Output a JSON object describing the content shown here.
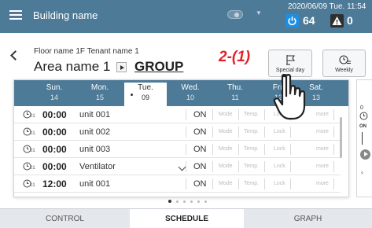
{
  "topbar": {
    "building_name": "Building name",
    "datetime": "2020/06/09 Tue. 11:54",
    "power_count": "64",
    "alert_count": "0",
    "dropdown_caret": "▼"
  },
  "header": {
    "floor_name": "Floor name 1F Tenant name 1",
    "area_name": "Area name 1",
    "group_label": "GROUP",
    "step_label": "2-(1)",
    "special_day_label": "Special day",
    "weekly_label": "Weekly"
  },
  "days": [
    {
      "name": "Sun.",
      "num": "14"
    },
    {
      "name": "Mon.",
      "num": "15"
    },
    {
      "name": "Tue.",
      "num": "09",
      "selected": true
    },
    {
      "name": "Wed.",
      "num": "10"
    },
    {
      "name": "Thu.",
      "num": "11"
    },
    {
      "name": "Fri.",
      "num": "12"
    },
    {
      "name": "Sat.",
      "num": "13"
    }
  ],
  "schedule_rows": [
    {
      "sub": "01",
      "time": "00:00",
      "name": "unit 001",
      "onoff": "ON",
      "mode": "Mode",
      "temp": "Temp.",
      "lock": "Lock",
      "more": "more"
    },
    {
      "sub": "01",
      "time": "00:00",
      "name": "unit 002",
      "onoff": "ON",
      "mode": "Mode",
      "temp": "Temp.",
      "lock": "Lock",
      "more": "more"
    },
    {
      "sub": "01",
      "time": "00:00",
      "name": "unit 003",
      "onoff": "ON",
      "mode": "Mode",
      "temp": "Temp.",
      "lock": "Lock",
      "more": "more"
    },
    {
      "sub": "01",
      "time": "00:00",
      "name": "Ventilator",
      "onoff": "ON",
      "mode": "Mode",
      "temp": "Temp.",
      "lock": "Lock",
      "more": "more"
    },
    {
      "sub": "01",
      "time": "12:00",
      "name": "unit 001",
      "onoff": "ON",
      "mode": "Mode",
      "temp": "Temp.",
      "lock": "Lock",
      "more": "more"
    }
  ],
  "peek": {
    "zero": "0",
    "on": "ON"
  },
  "tabs": {
    "control": "CONTROL",
    "schedule": "SCHEDULE",
    "graph": "GRAPH"
  },
  "colors": {
    "header_bg": "#4d7a97",
    "power_blue": "#1e8fe0",
    "step_red": "#e2232a"
  },
  "icons": [
    "menu-icon",
    "toggle-icon",
    "power-icon",
    "alert-icon",
    "back-arrow-icon",
    "play-icon",
    "flag-icon",
    "clock-list-icon",
    "clock-icon",
    "chevron-down-icon",
    "hand-pointer-icon"
  ]
}
